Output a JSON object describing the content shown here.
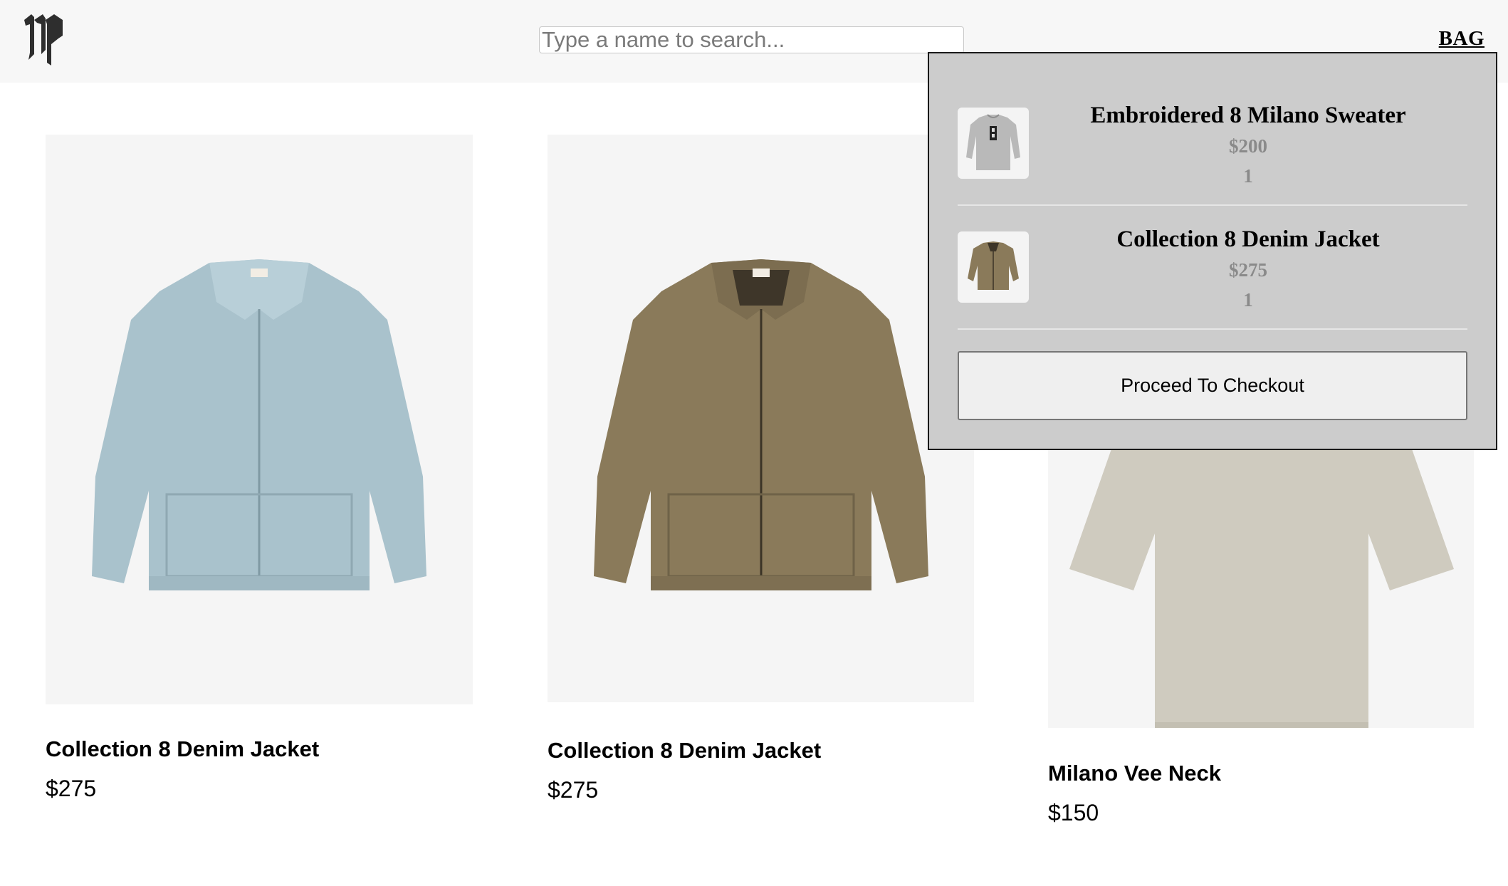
{
  "header": {
    "logo_icon": "gothic-monogram-logo-icon",
    "search": {
      "placeholder": "Type a name to search...",
      "value": ""
    },
    "bag_label": "BAG"
  },
  "products": [
    {
      "name": "Collection 8 Denim Jacket",
      "price": "$275",
      "image_icon": "light-blue-denim-jacket",
      "color": "#a9c2cc"
    },
    {
      "name": "Collection 8 Denim Jacket",
      "price": "$275",
      "image_icon": "olive-brown-denim-jacket",
      "color": "#8a7a5a"
    },
    {
      "name": "Milano Vee Neck",
      "price": "$150",
      "image_icon": "cream-tshirt",
      "color": "#cfcbbf"
    }
  ],
  "bag": {
    "items": [
      {
        "name": "Embroidered 8 Milano Sweater",
        "price": "$200",
        "quantity": "1",
        "thumb_icon": "grey-sweater-icon"
      },
      {
        "name": "Collection 8 Denim Jacket",
        "price": "$275",
        "quantity": "1",
        "thumb_icon": "brown-jacket-icon"
      }
    ],
    "checkout_label": "Proceed To Checkout"
  },
  "colors": {
    "header_bg": "#f7f7f7",
    "bag_panel_bg": "#cccccc",
    "muted_text": "#8a8a8a"
  }
}
